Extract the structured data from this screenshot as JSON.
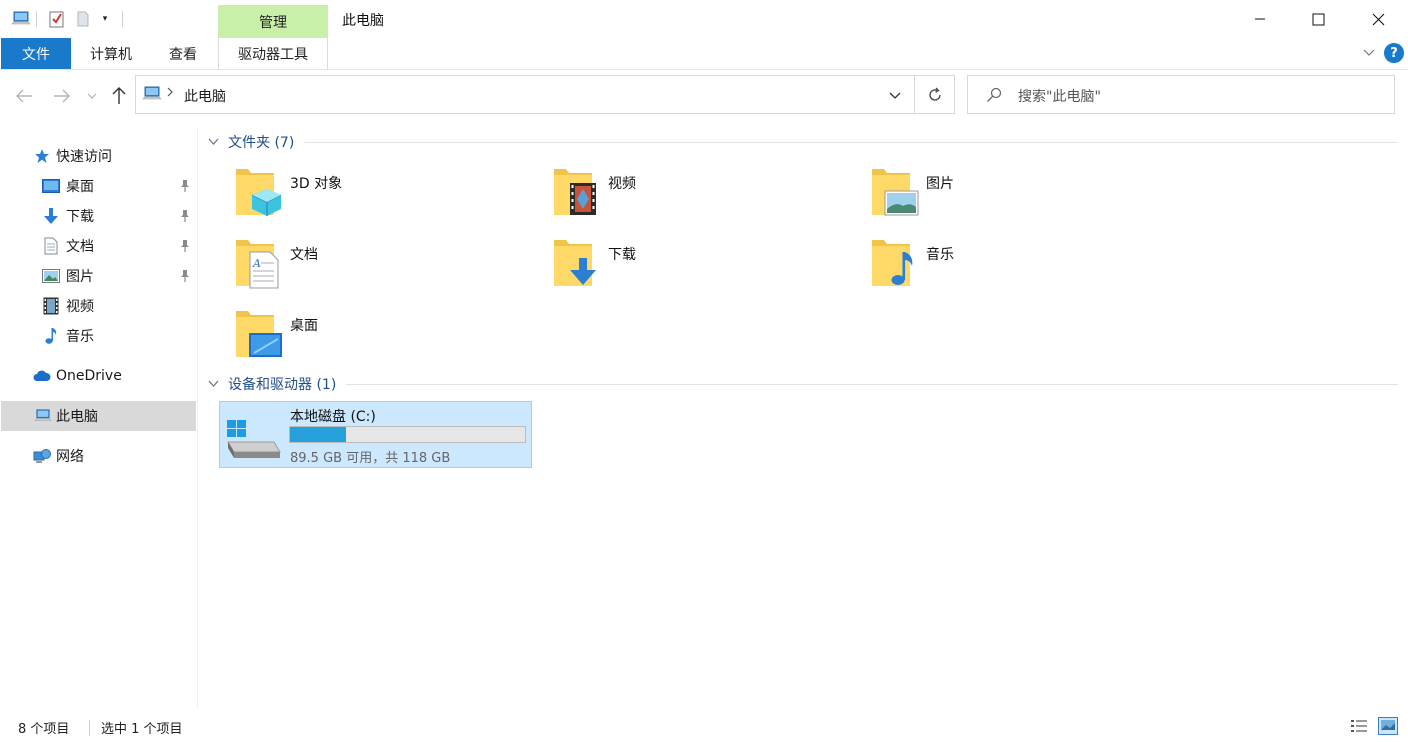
{
  "window": {
    "title": "此电脑",
    "context_tab_group": "管理",
    "colors": {
      "file_tab": "#1979ca",
      "manage_tab": "#c8f0a8",
      "selection": "#cce8ff",
      "drive_bar": "#26a0da",
      "group_header": "#1e4e8c"
    }
  },
  "ribbon": {
    "tabs": [
      {
        "label": "文件",
        "active": true
      },
      {
        "label": "计算机"
      },
      {
        "label": "查看"
      },
      {
        "label": "驱动器工具"
      }
    ]
  },
  "address": {
    "crumb": "此电脑",
    "search_placeholder": "搜索\"此电脑\""
  },
  "nav": {
    "quick_access": "快速访问",
    "quick_items": [
      {
        "label": "桌面",
        "icon": "desktop-icon",
        "pinned": true
      },
      {
        "label": "下载",
        "icon": "download-icon",
        "pinned": true
      },
      {
        "label": "文档",
        "icon": "document-icon",
        "pinned": true
      },
      {
        "label": "图片",
        "icon": "picture-icon",
        "pinned": true
      },
      {
        "label": "视频",
        "icon": "video-icon",
        "pinned": false
      },
      {
        "label": "音乐",
        "icon": "music-icon",
        "pinned": false
      }
    ],
    "onedrive": "OneDrive",
    "thispc": "此电脑",
    "network": "网络"
  },
  "content": {
    "folders_header": "文件夹 (7)",
    "folders": [
      {
        "label": "3D 对象",
        "icon": "3d-objects-folder-icon"
      },
      {
        "label": "视频",
        "icon": "video-folder-icon"
      },
      {
        "label": "图片",
        "icon": "picture-folder-icon"
      },
      {
        "label": "文档",
        "icon": "document-folder-icon"
      },
      {
        "label": "下载",
        "icon": "download-folder-icon"
      },
      {
        "label": "音乐",
        "icon": "music-folder-icon"
      },
      {
        "label": "桌面",
        "icon": "desktop-folder-icon"
      }
    ],
    "drives_header": "设备和驱动器 (1)",
    "drive": {
      "label": "本地磁盘 (C:)",
      "free_text": "89.5 GB 可用，共 118 GB",
      "used_fraction": 0.24
    }
  },
  "status": {
    "items": "8 个项目",
    "selected": "选中 1 个项目"
  }
}
